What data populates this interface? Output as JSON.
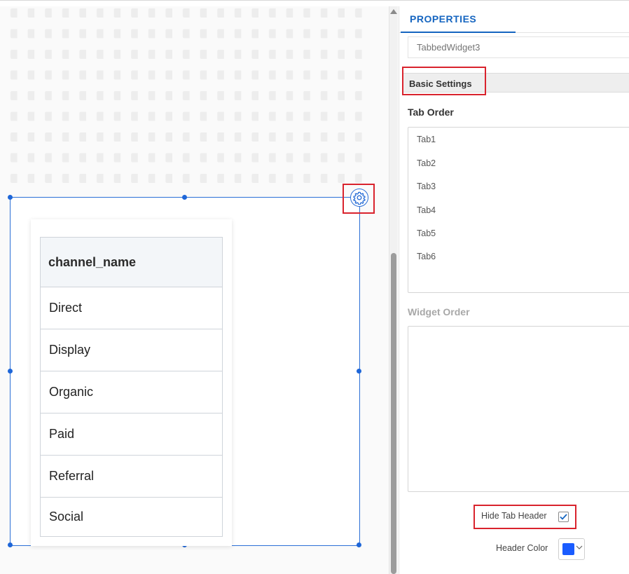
{
  "properties_panel": {
    "tab_label": "PROPERTIES",
    "widget_name_placeholder": "TabbedWidget3",
    "section_title": "Basic Settings",
    "tab_order_label": "Tab Order",
    "tabs": [
      {
        "label": "Tab1"
      },
      {
        "label": "Tab2"
      },
      {
        "label": "Tab3"
      },
      {
        "label": "Tab4"
      },
      {
        "label": "Tab5"
      },
      {
        "label": "Tab6"
      }
    ],
    "widget_order_label": "Widget Order",
    "hide_tab_header_label": "Hide Tab Header",
    "hide_tab_header_checked": true,
    "header_color_label": "Header Color",
    "header_color_value": "#1a5cff"
  },
  "canvas": {
    "table": {
      "column_header": "channel_name",
      "rows": [
        "Direct",
        "Display",
        "Organic",
        "Paid",
        "Referral",
        "Social"
      ]
    },
    "settings_icon": "gear-icon"
  },
  "colors": {
    "accent": "#1565c0",
    "selection": "#2b6fd6",
    "highlight": "#d9232d"
  }
}
